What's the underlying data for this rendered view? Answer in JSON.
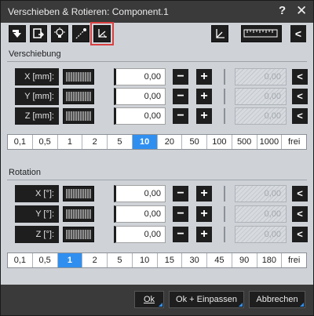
{
  "window": {
    "title": "Verschieben & Rotieren: Component.1",
    "help_glyph": "?",
    "close_glyph": "✕"
  },
  "toolbar": {
    "icons": [
      "move-component-icon",
      "align-icon",
      "lightbulb-icon",
      "point-move-icon",
      "axis-system-icon"
    ],
    "right_icons": [
      "coordinate-axes-icon",
      "ruler-icon",
      "collapse-icon"
    ]
  },
  "translation": {
    "header": "Verschiebung",
    "rows": [
      {
        "label": "X [mm]:",
        "value": "0,00",
        "ref": "0,00"
      },
      {
        "label": "Y [mm]:",
        "value": "0,00",
        "ref": "0,00"
      },
      {
        "label": "Z [mm]:",
        "value": "0,00",
        "ref": "0,00"
      }
    ],
    "steps": [
      "0,1",
      "0,5",
      "1",
      "2",
      "5",
      "10",
      "20",
      "50",
      "100",
      "500",
      "1000",
      "frei"
    ],
    "selected_step": "10"
  },
  "rotation": {
    "header": "Rotation",
    "rows": [
      {
        "label": "X [°]:",
        "value": "0,00",
        "ref": "0,00"
      },
      {
        "label": "Y [°]:",
        "value": "0,00",
        "ref": "0,00"
      },
      {
        "label": "Z [°]:",
        "value": "0,00",
        "ref": "0,00"
      }
    ],
    "steps": [
      "0,1",
      "0,5",
      "1",
      "2",
      "5",
      "10",
      "15",
      "30",
      "45",
      "90",
      "180",
      "frei"
    ],
    "selected_step": "1"
  },
  "buttons": {
    "minus": "−",
    "plus": "+",
    "back": "<"
  },
  "footer": {
    "ok": "Ok",
    "ok_fit": "Ok + Einpassen",
    "cancel": "Abbrechen"
  },
  "colors": {
    "accent": "#2f8ff0",
    "highlight": "#d94040"
  }
}
